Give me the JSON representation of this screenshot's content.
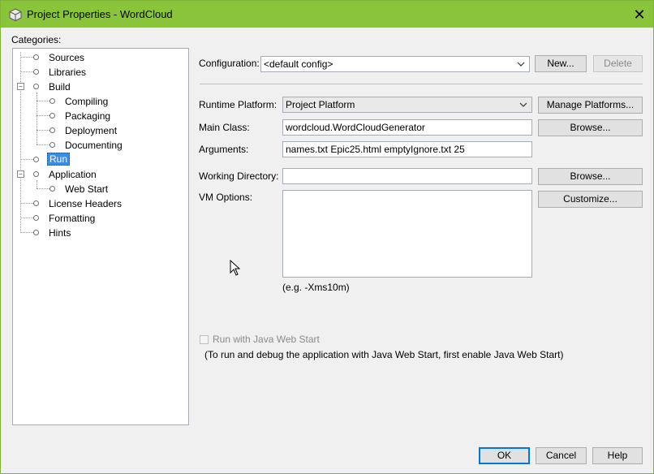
{
  "window": {
    "title": "Project Properties - WordCloud"
  },
  "categories": {
    "label": "Categories:",
    "items": [
      {
        "label": "Sources"
      },
      {
        "label": "Libraries"
      },
      {
        "label": "Build"
      },
      {
        "label": "Compiling"
      },
      {
        "label": "Packaging"
      },
      {
        "label": "Deployment"
      },
      {
        "label": "Documenting"
      },
      {
        "label": "Run"
      },
      {
        "label": "Application"
      },
      {
        "label": "Web Start"
      },
      {
        "label": "License Headers"
      },
      {
        "label": "Formatting"
      },
      {
        "label": "Hints"
      }
    ],
    "selected": "Run"
  },
  "config": {
    "label": "Configuration:",
    "value": "<default config>",
    "new_label": "New...",
    "delete_label": "Delete"
  },
  "form": {
    "runtime_label": "Runtime Platform:",
    "runtime_value": "Project Platform",
    "manage_label": "Manage Platforms...",
    "main_class_label": "Main Class:",
    "main_class_value": "wordcloud.WordCloudGenerator",
    "browse_label": "Browse...",
    "arguments_label": "Arguments:",
    "arguments_value": "names.txt Epic25.html emptyIgnore.txt 25",
    "working_dir_label": "Working Directory:",
    "working_dir_value": "",
    "vm_options_label": "VM Options:",
    "customize_label": "Customize...",
    "vm_hint": "(e.g. -Xms10m)",
    "webstart_label": "Run with Java Web Start",
    "webstart_note": "(To run and debug the application with Java Web Start, first enable Java Web Start)"
  },
  "footer": {
    "ok_label": "OK",
    "cancel_label": "Cancel",
    "help_label": "Help"
  },
  "colors": {
    "titlebar": "#8ac43a",
    "selection": "#3c8de0",
    "primary_border": "#0078d7"
  },
  "icons": {
    "app": "project-cube-icon",
    "close": "close-icon",
    "dropdown": "chevron-down-icon",
    "cursor": "mouse-pointer-icon"
  }
}
